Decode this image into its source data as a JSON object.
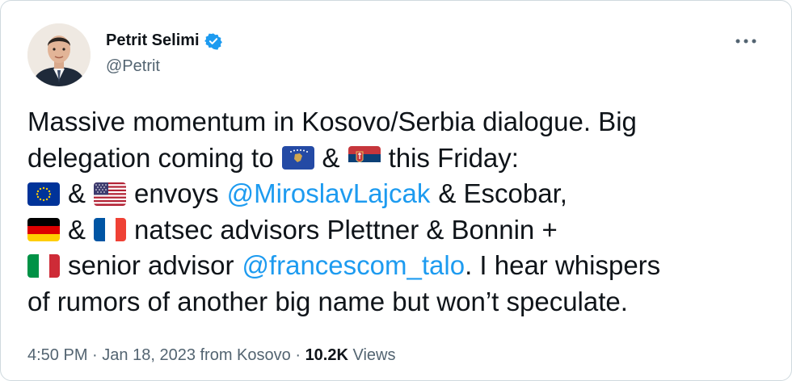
{
  "author": {
    "name": "Petrit Selimi",
    "handle": "@Petrit",
    "verified": true
  },
  "icons": {
    "verified": "verified-badge-icon",
    "more": "more-options-icon",
    "flags": [
      "kosovo-flag-icon",
      "serbia-flag-icon",
      "eu-flag-icon",
      "usa-flag-icon",
      "germany-flag-icon",
      "france-flag-icon",
      "italy-flag-icon"
    ]
  },
  "tweet": {
    "line1": "Massive momentum in Kosovo/Serbia dialogue. Big",
    "line2a": "delegation coming to",
    "line2amp": "&",
    "line2b": "this Friday:",
    "line3amp": "&",
    "line3a": "envoys",
    "mention1": "@MiroslavLajcak",
    "line3b": "& Escobar,",
    "line4amp": "&",
    "line4a": "natsec advisors Plettner & Bonnin +",
    "line5a": "senior advisor",
    "mention2": "@francescom_talo",
    "line5b": ". I hear whispers",
    "line6": "of rumors of another big name but won’t speculate."
  },
  "meta": {
    "time": "4:50 PM",
    "sep1": "·",
    "date": "Jan 18, 2023",
    "source": "from Kosovo",
    "sep2": "·",
    "views_count": "10.2K",
    "views_label": "Views"
  },
  "colors": {
    "accent": "#1d9bf0",
    "text": "#0f1419",
    "secondary": "#536471",
    "border": "#cfd9de"
  }
}
